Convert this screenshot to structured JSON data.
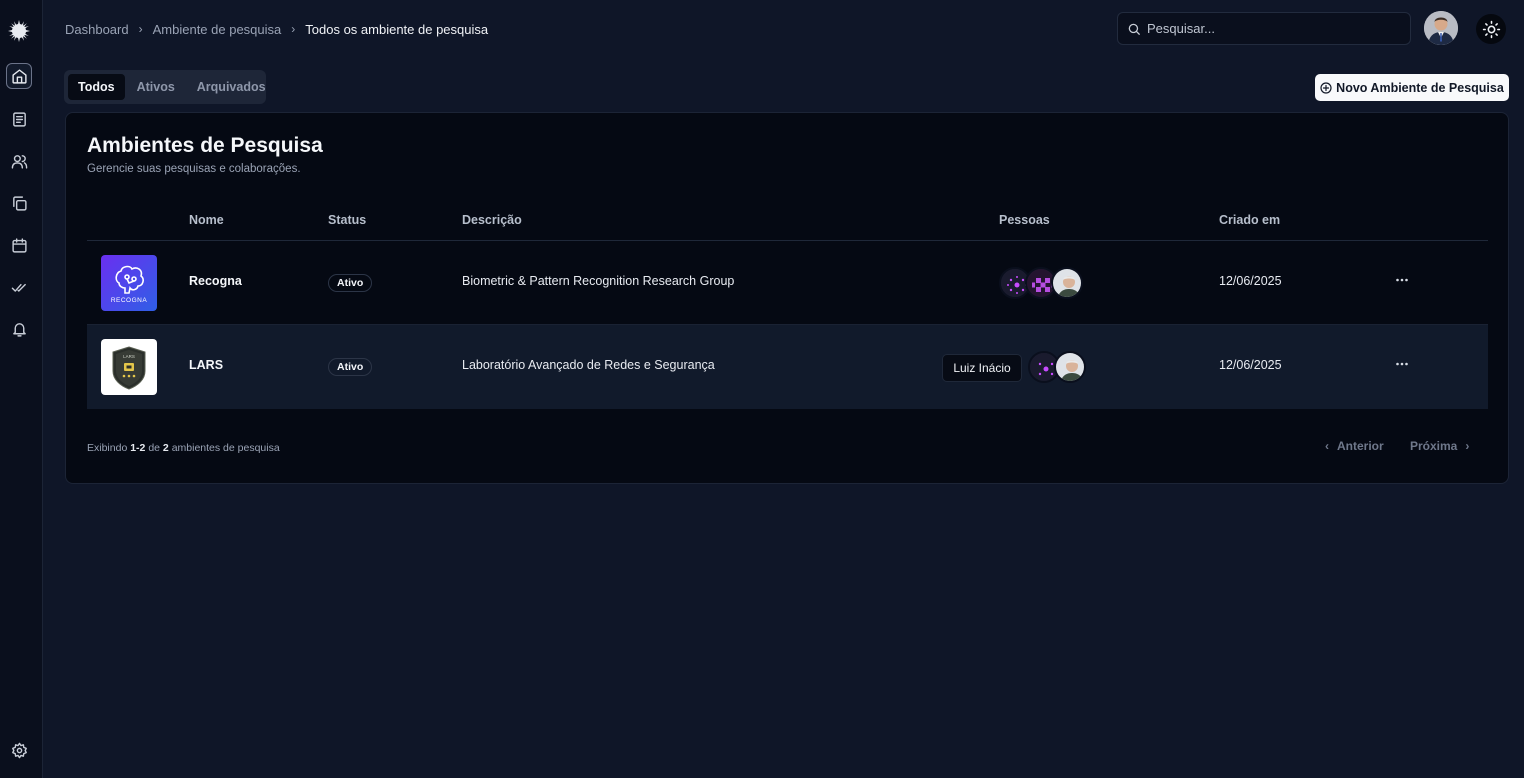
{
  "colors": {
    "background": "#0f1628",
    "sidebar": "#0a0f1d",
    "card": "#050913",
    "accent_button": "#f8f9fb",
    "recogna_brand": "#4b3ae0"
  },
  "sidebar": {
    "logo": "sunburst-logo-icon",
    "items": [
      {
        "icon": "home-icon",
        "active": true
      },
      {
        "icon": "book-icon"
      },
      {
        "icon": "users-icon"
      },
      {
        "icon": "copy-icon"
      },
      {
        "icon": "calendar-icon"
      },
      {
        "icon": "double-check-icon"
      },
      {
        "icon": "bell-icon"
      },
      {
        "icon": "gear-icon"
      }
    ]
  },
  "header": {
    "breadcrumb": [
      "Dashboard",
      "Ambiente de pesquisa",
      "Todos os ambiente de pesquisa"
    ],
    "search_placeholder": "Pesquisar...",
    "theme_toggle_icon": "sun-icon"
  },
  "tabs": [
    {
      "label": "Todos",
      "active": true
    },
    {
      "label": "Ativos"
    },
    {
      "label": "Arquivados"
    }
  ],
  "new_button_label": "Novo Ambiente de Pesquisa",
  "card": {
    "title": "Ambientes de Pesquisa",
    "subtitle": "Gerencie suas pesquisas e colaborações."
  },
  "table": {
    "columns": [
      "Nome",
      "Status",
      "Descrição",
      "Pessoas",
      "Criado em"
    ],
    "rows": [
      {
        "logo_text": "RECOGNA",
        "name": "Recogna",
        "status": "Ativo",
        "description": "Biometric & Pattern Recognition Research Group",
        "people_count": 3,
        "created": "12/06/2025"
      },
      {
        "logo_text": "LARS",
        "name": "LARS",
        "status": "Ativo",
        "description": "Laboratório Avançado de Redes e Segurança",
        "people_count": 2,
        "created": "12/06/2025"
      }
    ]
  },
  "tooltip": "Luiz Inácio",
  "pagination": {
    "prefix": "Exibindo",
    "range": "1-2",
    "of": "de",
    "total": "2",
    "suffix": "ambientes de pesquisa",
    "prev": "Anterior",
    "next": "Próxima"
  }
}
